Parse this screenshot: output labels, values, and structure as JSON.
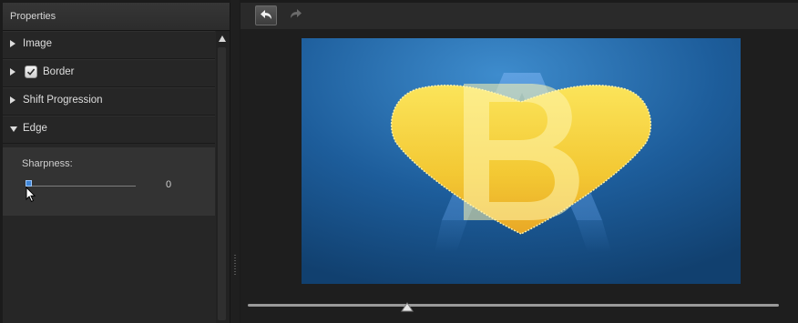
{
  "panel": {
    "title": "Properties",
    "sections": [
      {
        "label": "Image",
        "expanded": false,
        "has_checkbox": false
      },
      {
        "label": "Border",
        "expanded": false,
        "has_checkbox": true,
        "checked": true
      },
      {
        "label": "Shift Progression",
        "expanded": false,
        "has_checkbox": false
      },
      {
        "label": "Edge",
        "expanded": true,
        "has_checkbox": false
      }
    ],
    "edge": {
      "sharpness_label": "Sharpness:",
      "sharpness_value": "0",
      "sharpness_level": 0
    }
  },
  "toolbar": {
    "undo_icon": "undo-icon",
    "redo_icon": "redo-icon",
    "redo_enabled": false
  },
  "preview": {
    "content": "heart-shaped yellow image with letter B over blue background with letter A",
    "timeline_position": 0.3
  },
  "colors": {
    "accent": "#3f86d8",
    "background_blue": "#1f5e9c",
    "heart_yellow": "#f2c531"
  }
}
